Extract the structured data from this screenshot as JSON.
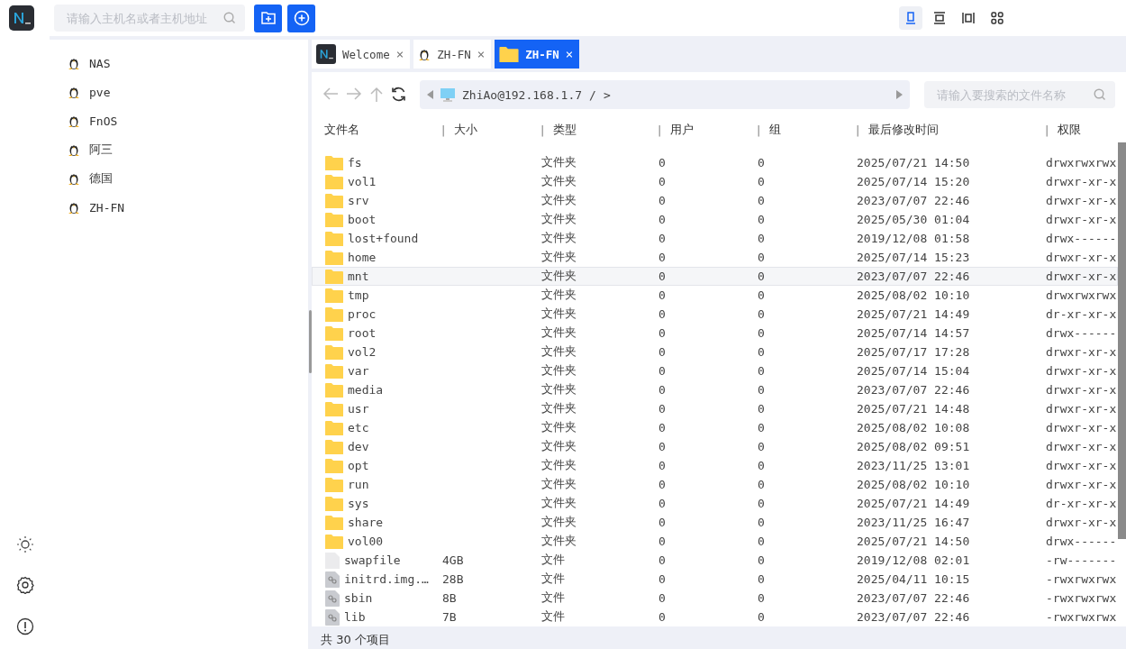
{
  "search": {
    "placeholder": "请输入主机名或者主机地址"
  },
  "view_modes": [
    {
      "kind": "single",
      "selected": true
    },
    {
      "kind": "rows",
      "selected": false
    },
    {
      "kind": "columns",
      "selected": false
    },
    {
      "kind": "grid",
      "selected": false
    }
  ],
  "hosts": [
    {
      "name": "NAS"
    },
    {
      "name": "pve"
    },
    {
      "name": "FnOS"
    },
    {
      "name": "阿三"
    },
    {
      "name": "德国"
    },
    {
      "name": "ZH-FN"
    }
  ],
  "tabs": [
    {
      "kind": "logo",
      "label": "Welcome",
      "close": "×",
      "selected": false
    },
    {
      "kind": "linux",
      "label": "ZH-FN",
      "close": "×",
      "selected": false
    },
    {
      "kind": "folder",
      "label": "ZH-FN",
      "close": "×",
      "selected": true
    }
  ],
  "path": {
    "host": "ZhiAo@192.168.1.7",
    "segment": "/",
    "more": ">"
  },
  "file_search": {
    "placeholder": "请输入要搜索的文件名称"
  },
  "columns": [
    {
      "label": "文件名"
    },
    {
      "divider": "|",
      "label": "大小"
    },
    {
      "divider": "|",
      "label": "类型"
    },
    {
      "divider": "|",
      "label": "用户"
    },
    {
      "divider": "|",
      "label": "组"
    },
    {
      "divider": "|",
      "label": "最后修改时间"
    },
    {
      "divider": "|",
      "label": "权限"
    }
  ],
  "rows": [
    {
      "kind": "folder",
      "name": "fs",
      "type": "文件夹",
      "user": "0",
      "group": "0",
      "modified": "2025/07/21 14:50",
      "perm": "drwxrwxrwx",
      "selected": false
    },
    {
      "kind": "folder",
      "name": "vol1",
      "type": "文件夹",
      "user": "0",
      "group": "0",
      "modified": "2025/07/14 15:20",
      "perm": "drwxr-xr-x",
      "selected": false
    },
    {
      "kind": "folder",
      "name": "srv",
      "type": "文件夹",
      "user": "0",
      "group": "0",
      "modified": "2023/07/07 22:46",
      "perm": "drwxr-xr-x",
      "selected": false
    },
    {
      "kind": "folder",
      "name": "boot",
      "type": "文件夹",
      "user": "0",
      "group": "0",
      "modified": "2025/05/30 01:04",
      "perm": "drwxr-xr-x",
      "selected": false
    },
    {
      "kind": "folder",
      "name": "lost+found",
      "type": "文件夹",
      "user": "0",
      "group": "0",
      "modified": "2019/12/08 01:58",
      "perm": "drwx------",
      "selected": false
    },
    {
      "kind": "folder",
      "name": "home",
      "type": "文件夹",
      "user": "0",
      "group": "0",
      "modified": "2025/07/14 15:23",
      "perm": "drwxr-xr-x",
      "selected": false
    },
    {
      "kind": "folder",
      "name": "mnt",
      "type": "文件夹",
      "user": "0",
      "group": "0",
      "modified": "2023/07/07 22:46",
      "perm": "drwxr-xr-x",
      "selected": true
    },
    {
      "kind": "folder",
      "name": "tmp",
      "type": "文件夹",
      "user": "0",
      "group": "0",
      "modified": "2025/08/02 10:10",
      "perm": "drwxrwxrwx",
      "selected": false
    },
    {
      "kind": "folder",
      "name": "proc",
      "type": "文件夹",
      "user": "0",
      "group": "0",
      "modified": "2025/07/21 14:49",
      "perm": "dr-xr-xr-x",
      "selected": false
    },
    {
      "kind": "folder",
      "name": "root",
      "type": "文件夹",
      "user": "0",
      "group": "0",
      "modified": "2025/07/14 14:57",
      "perm": "drwx------",
      "selected": false
    },
    {
      "kind": "folder",
      "name": "vol2",
      "type": "文件夹",
      "user": "0",
      "group": "0",
      "modified": "2025/07/17 17:28",
      "perm": "drwxr-xr-x",
      "selected": false
    },
    {
      "kind": "folder",
      "name": "var",
      "type": "文件夹",
      "user": "0",
      "group": "0",
      "modified": "2025/07/14 15:04",
      "perm": "drwxr-xr-x",
      "selected": false
    },
    {
      "kind": "folder",
      "name": "media",
      "type": "文件夹",
      "user": "0",
      "group": "0",
      "modified": "2023/07/07 22:46",
      "perm": "drwxr-xr-x",
      "selected": false
    },
    {
      "kind": "folder",
      "name": "usr",
      "type": "文件夹",
      "user": "0",
      "group": "0",
      "modified": "2025/07/21 14:48",
      "perm": "drwxr-xr-x",
      "selected": false
    },
    {
      "kind": "folder",
      "name": "etc",
      "type": "文件夹",
      "user": "0",
      "group": "0",
      "modified": "2025/08/02 10:08",
      "perm": "drwxr-xr-x",
      "selected": false
    },
    {
      "kind": "folder",
      "name": "dev",
      "type": "文件夹",
      "user": "0",
      "group": "0",
      "modified": "2025/08/02 09:51",
      "perm": "drwxr-xr-x",
      "selected": false
    },
    {
      "kind": "folder",
      "name": "opt",
      "type": "文件夹",
      "user": "0",
      "group": "0",
      "modified": "2023/11/25 13:01",
      "perm": "drwxr-xr-x",
      "selected": false
    },
    {
      "kind": "folder",
      "name": "run",
      "type": "文件夹",
      "user": "0",
      "group": "0",
      "modified": "2025/08/02 10:10",
      "perm": "drwxr-xr-x",
      "selected": false
    },
    {
      "kind": "folder",
      "name": "sys",
      "type": "文件夹",
      "user": "0",
      "group": "0",
      "modified": "2025/07/21 14:49",
      "perm": "dr-xr-xr-x",
      "selected": false
    },
    {
      "kind": "folder",
      "name": "share",
      "type": "文件夹",
      "user": "0",
      "group": "0",
      "modified": "2023/11/25 16:47",
      "perm": "drwxr-xr-x",
      "selected": false
    },
    {
      "kind": "folder",
      "name": "vol00",
      "type": "文件夹",
      "user": "0",
      "group": "0",
      "modified": "2025/07/21 14:50",
      "perm": "drwx------",
      "selected": false
    },
    {
      "kind": "file",
      "name": "swapfile",
      "size": "4GB",
      "type": "文件",
      "user": "0",
      "group": "0",
      "modified": "2019/12/08 02:01",
      "perm": "-rw-------",
      "selected": false
    },
    {
      "kind": "link",
      "name": "initrd.img.…",
      "size": "28B",
      "type": "文件",
      "user": "0",
      "group": "0",
      "modified": "2025/04/11 10:15",
      "perm": "-rwxrwxrwx",
      "selected": false
    },
    {
      "kind": "link",
      "name": "sbin",
      "size": "8B",
      "type": "文件",
      "user": "0",
      "group": "0",
      "modified": "2023/07/07 22:46",
      "perm": "-rwxrwxrwx",
      "selected": false
    },
    {
      "kind": "link",
      "name": "lib",
      "size": "7B",
      "type": "文件",
      "user": "0",
      "group": "0",
      "modified": "2023/07/07 22:46",
      "perm": "-rwxrwxrwx",
      "selected": false
    }
  ],
  "status_bar": {
    "total": "共 30 个项目"
  }
}
